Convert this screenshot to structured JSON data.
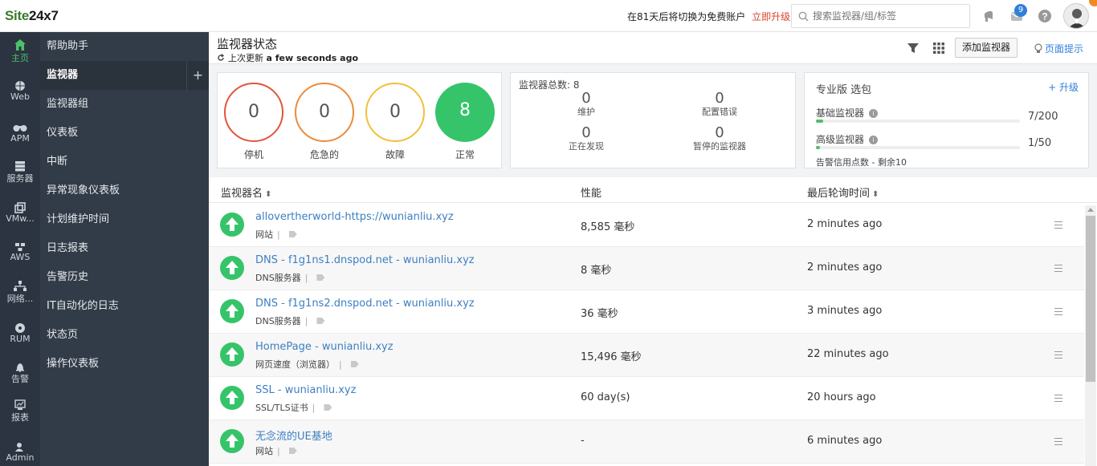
{
  "app": {
    "logo_main": "Site",
    "logo_num": "24x7"
  },
  "topbar": {
    "trial_text": "在81天后将切换为免费账户",
    "upgrade_label": "立即升级",
    "search_placeholder": "搜索监视器/组/标签",
    "notification_count": "9"
  },
  "rail": [
    {
      "label": "主页",
      "icon": "home-icon",
      "active": true
    },
    {
      "label": "Web",
      "icon": "globe-icon"
    },
    {
      "label": "APM",
      "icon": "binoculars-icon"
    },
    {
      "label": "服务器",
      "icon": "server-icon"
    },
    {
      "label": "VMw...",
      "icon": "vmware-icon"
    },
    {
      "label": "AWS",
      "icon": "aws-icon"
    },
    {
      "label": "网络...",
      "icon": "network-icon"
    },
    {
      "label": "RUM",
      "icon": "rum-icon"
    },
    {
      "label": "告警",
      "icon": "bell-icon"
    },
    {
      "label": "报表",
      "icon": "report-icon"
    },
    {
      "label": "Admin",
      "icon": "admin-icon"
    }
  ],
  "menu": [
    {
      "label": "帮助助手"
    },
    {
      "label": "监视器",
      "active": true
    },
    {
      "label": "监视器组"
    },
    {
      "label": "仪表板"
    },
    {
      "label": "中断"
    },
    {
      "label": "异常现象仪表板"
    },
    {
      "label": "计划维护时间"
    },
    {
      "label": "日志报表"
    },
    {
      "label": "告警历史"
    },
    {
      "label": "IT自动化的日志"
    },
    {
      "label": "状态页"
    },
    {
      "label": "操作仪表板"
    }
  ],
  "header": {
    "title": "监视器状态",
    "last_updated_label": "上次更新",
    "last_updated_value": "a few seconds ago",
    "add_monitor": "添加监视器",
    "page_tips": "页面提示"
  },
  "status_counts": [
    {
      "label": "停机",
      "value": "0",
      "color": "#e0553f"
    },
    {
      "label": "危急的",
      "value": "0",
      "color": "#ec8a3c"
    },
    {
      "label": "故障",
      "value": "0",
      "color": "#f2c037"
    },
    {
      "label": "正常",
      "value": "8",
      "color": "#35c46a"
    }
  ],
  "summary": {
    "title": "监视器总数: 8",
    "cells": [
      {
        "value": "0",
        "label": "维护"
      },
      {
        "value": "0",
        "label": "配置错误"
      },
      {
        "value": "0",
        "label": "正在发现"
      },
      {
        "value": "0",
        "label": "暂停的监视器"
      }
    ]
  },
  "plan": {
    "title": "专业版 选包",
    "upgrade": "+ 升级",
    "rows": [
      {
        "label": "基础监视器",
        "count": "7/200",
        "fraction": 0.035
      },
      {
        "label": "高级监视器",
        "count": "1/50",
        "fraction": 0.02
      }
    ],
    "footer": "告警信用点数 - 剩余10"
  },
  "table": {
    "columns": {
      "name": "监视器名",
      "perf": "性能",
      "poll": "最后轮询时间"
    },
    "rows": [
      {
        "name": "allovertherworld-https://wunianliu.xyz",
        "type": "网站",
        "perf": "8,585 毫秒",
        "poll": "2 minutes ago"
      },
      {
        "name": "DNS - f1g1ns1.dnspod.net - wunianliu.xyz",
        "type": "DNS服务器",
        "perf": "8 毫秒",
        "poll": "2 minutes ago"
      },
      {
        "name": "DNS - f1g1ns2.dnspod.net - wunianliu.xyz",
        "type": "DNS服务器",
        "perf": "36 毫秒",
        "poll": "3 minutes ago"
      },
      {
        "name": "HomePage - wunianliu.xyz",
        "type": "网页速度（浏览器）",
        "perf": "15,496 毫秒",
        "poll": "22 minutes ago"
      },
      {
        "name": "SSL - wunianliu.xyz",
        "type": "SSL/TLS证书",
        "perf": "60 day(s)",
        "poll": "20 hours ago"
      },
      {
        "name": "无念流的UE基地",
        "type": "网站",
        "perf": "-",
        "poll": "6 minutes ago"
      }
    ]
  }
}
